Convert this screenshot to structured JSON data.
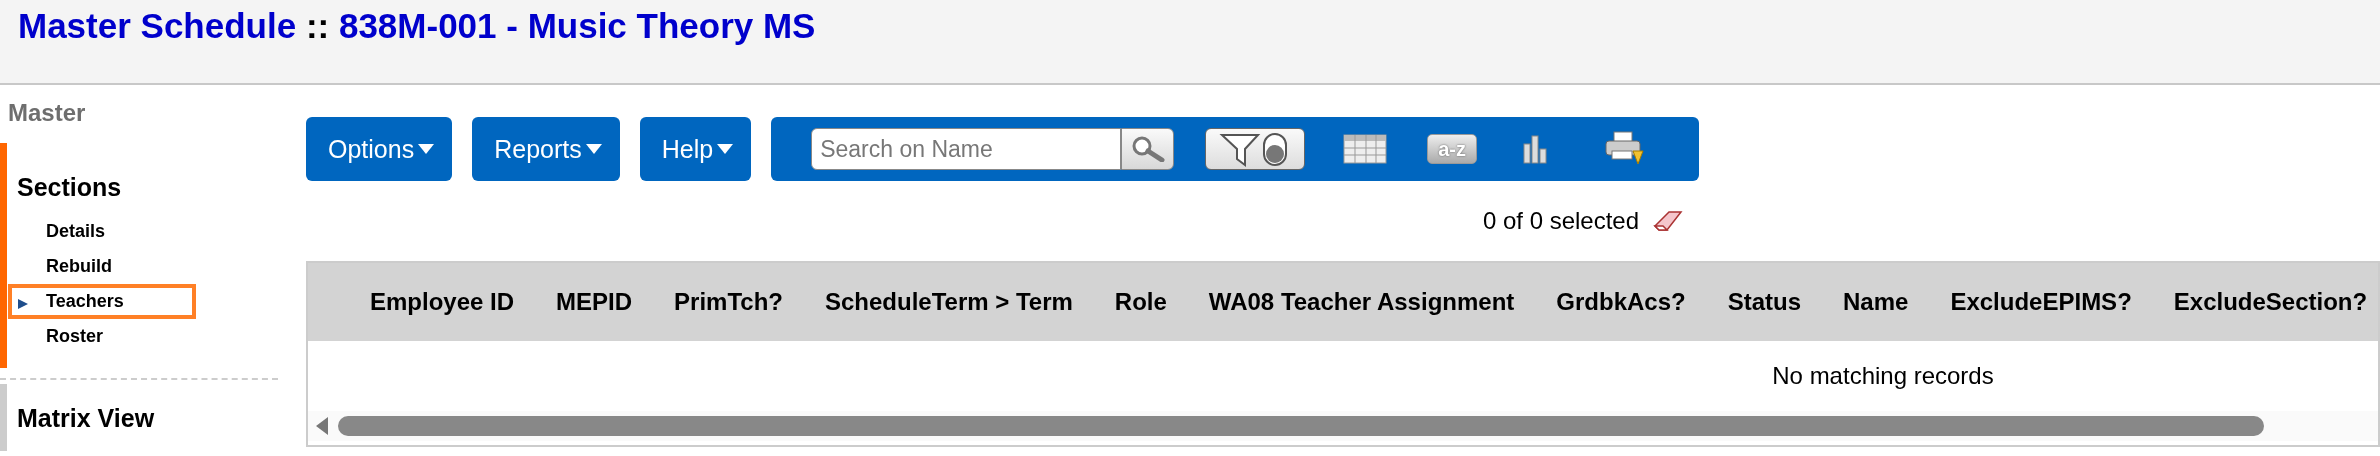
{
  "title": {
    "module": "Master Schedule",
    "separator": "::",
    "record": "838M-001 - Music Theory MS"
  },
  "sidebar": {
    "heading": "Master",
    "groups": [
      {
        "title": "Sections",
        "active": true,
        "items": [
          {
            "label": "Details",
            "selected": false
          },
          {
            "label": "Rebuild",
            "selected": false
          },
          {
            "label": "Teachers",
            "selected": true
          },
          {
            "label": "Roster",
            "selected": false
          }
        ]
      },
      {
        "title": "Matrix View",
        "active": false
      }
    ]
  },
  "toolbar": {
    "menus": [
      {
        "label": "Options"
      },
      {
        "label": "Reports"
      },
      {
        "label": "Help"
      }
    ],
    "search": {
      "placeholder": "Search on Name"
    },
    "filter": {
      "on": false
    },
    "sort_label": "a-z"
  },
  "selection": {
    "text": "0 of 0 selected"
  },
  "table": {
    "columns": [
      "Employee ID",
      "MEPID",
      "PrimTch?",
      "ScheduleTerm > Term",
      "Role",
      "WA08 Teacher Assignment",
      "GrdbkAcs?",
      "Status",
      "Name",
      "ExcludeEPIMS?",
      "ExcludeSection?"
    ],
    "empty_message": "No matching records"
  }
}
